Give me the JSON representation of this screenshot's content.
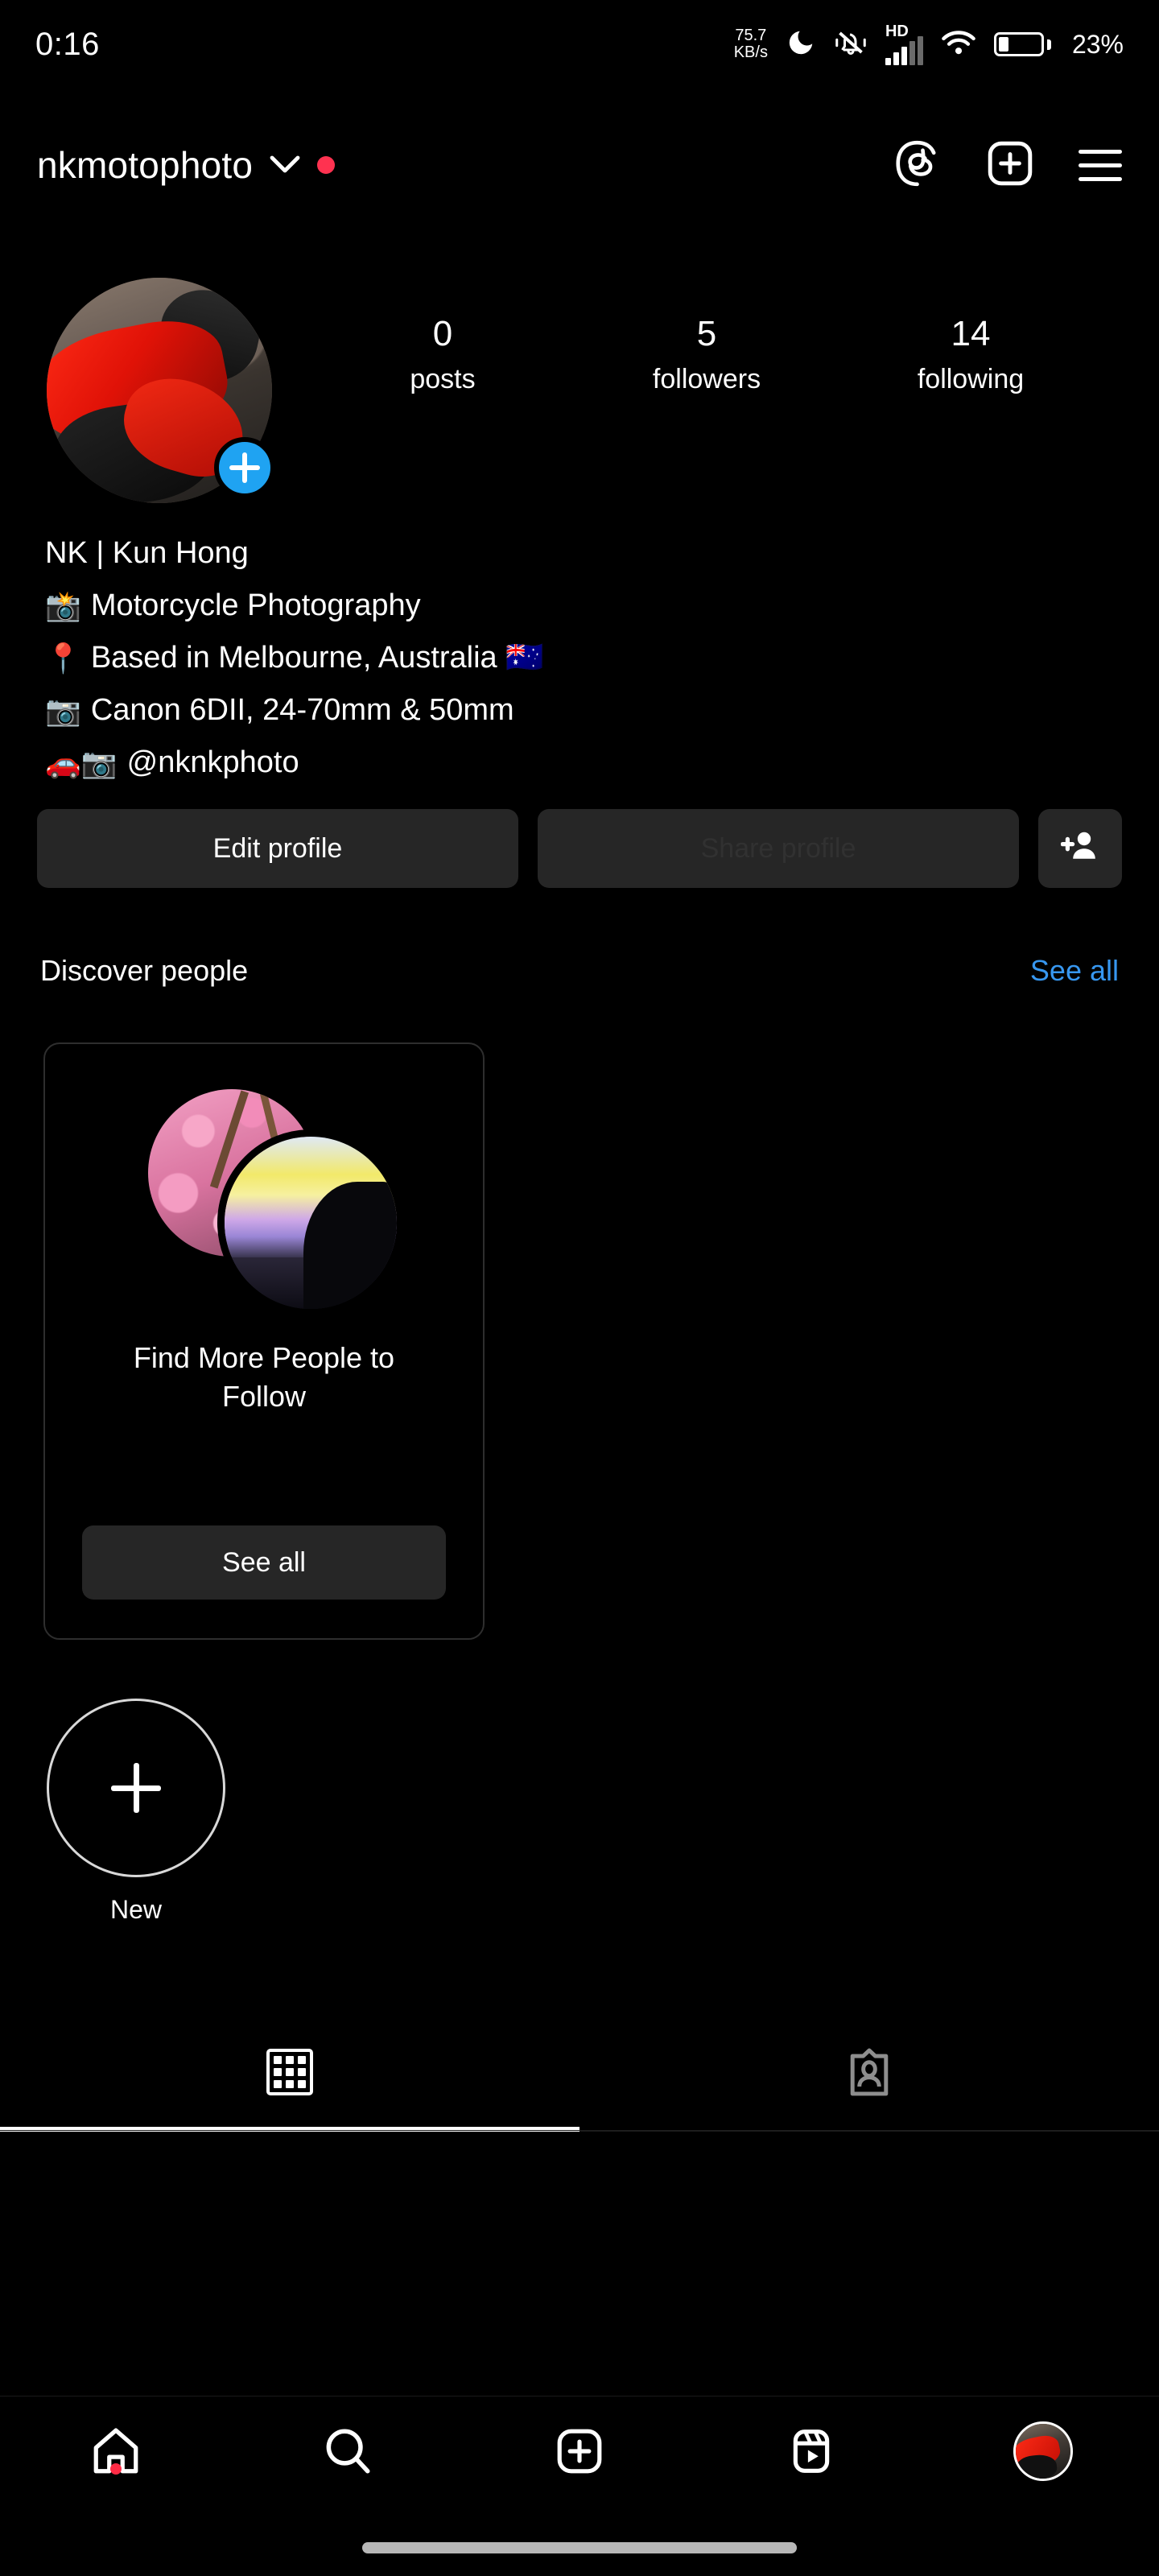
{
  "status_bar": {
    "clock": "0:16",
    "net_speed_value": "75.7",
    "net_speed_unit": "KB/s",
    "dnd_icon": "moon-icon",
    "mute_icon": "bell-muted-icon",
    "hd_label": "HD",
    "signal_icon": "signal-bars-icon",
    "wifi_icon": "wifi-icon",
    "battery_icon": "battery-icon",
    "battery_percent": "23%"
  },
  "header": {
    "username": "nkmotophoto",
    "chevron_icon": "chevron-down-icon",
    "unread_badge": "red-dot-badge",
    "threads_icon": "threads-icon",
    "create_icon": "plus-box-icon",
    "menu_icon": "hamburger-menu-icon"
  },
  "profile": {
    "avatar_alt": "profile-photo-red-motorcycle",
    "add_story_icon": "plus-icon",
    "stats": [
      {
        "count": "0",
        "label": "posts"
      },
      {
        "count": "5",
        "label": "followers"
      },
      {
        "count": "14",
        "label": "following"
      }
    ],
    "bio": [
      {
        "emoji": "",
        "text": "NK  |  Kun Hong"
      },
      {
        "emoji": "📸",
        "text": "Motorcycle Photography"
      },
      {
        "emoji": "📍",
        "text": "Based in Melbourne, Australia 🇦🇺"
      },
      {
        "emoji": "📷",
        "text": "Canon 6DII, 24-70mm & 50mm"
      },
      {
        "emoji": "🚗📷",
        "text": "@nknkphoto"
      }
    ]
  },
  "actions": {
    "edit_profile": "Edit profile",
    "share_profile": "Share profile",
    "add_user_icon": "add-person-icon"
  },
  "discover": {
    "title": "Discover people",
    "see_all_link": "See all",
    "card": {
      "avatar_back_alt": "cherry-blossom-avatar",
      "avatar_front_alt": "sunset-silhouette-avatar",
      "title": "Find More People to Follow",
      "button": "See all"
    }
  },
  "highlights": [
    {
      "icon": "plus-icon",
      "label": "New"
    }
  ],
  "tabs": [
    {
      "icon": "grid-icon",
      "name": "posts-grid-tab",
      "active": true
    },
    {
      "icon": "tagged-icon",
      "name": "tagged-tab",
      "active": false
    }
  ],
  "bottom_nav": [
    {
      "icon": "home-icon",
      "name": "nav-home",
      "badge": true
    },
    {
      "icon": "search-icon",
      "name": "nav-search",
      "badge": false
    },
    {
      "icon": "plus-box-icon",
      "name": "nav-create",
      "badge": false
    },
    {
      "icon": "reels-icon",
      "name": "nav-reels",
      "badge": false
    },
    {
      "icon": "avatar-icon",
      "name": "nav-profile",
      "badge": false
    }
  ],
  "colors": {
    "background": "#000000",
    "button_bg": "#262626",
    "accent_blue": "#3797f0",
    "story_blue": "#1fa3f2",
    "badge_red": "#ff3250"
  }
}
